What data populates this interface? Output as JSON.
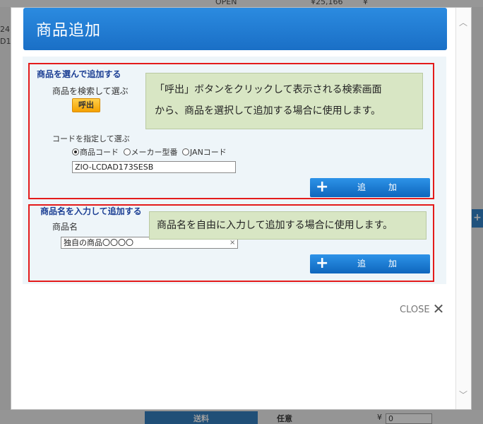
{
  "background": {
    "top_cells": [
      "OPEN",
      "¥25,166",
      "¥"
    ],
    "left_fragments": [
      "24",
      "D1"
    ],
    "right_tab": "+",
    "bottom_blue_label": "送料",
    "bottom_label": "任意",
    "bottom_yen": "¥",
    "bottom_input_value": "0"
  },
  "modal": {
    "title": "商品追加",
    "section_select": {
      "title": "商品を選んで追加する",
      "search_label": "商品を検索して選ぶ",
      "call_button": "呼出",
      "code_label": "コードを指定して選ぶ",
      "radio_options": [
        "商品コード",
        "メーカー型番",
        "JANコード"
      ],
      "selected_radio": "商品コード",
      "code_value": "ZIO-LCDAD173SESB",
      "add_button": "追　加"
    },
    "section_name": {
      "title": "商品名を入力して追加する",
      "name_label": "商品名",
      "name_value": "独自の商品〇〇〇〇",
      "clear_icon": "×",
      "add_button": "追　加"
    },
    "callout_select": "「呼出」ボタンをクリックして表示される検索画面から、商品を選択して追加する場合に使用します。",
    "callout_select_line1": "「呼出」ボタンをクリックして表示される検索画面",
    "callout_select_line2": "から、商品を選択して追加する場合に使用します。",
    "callout_name": "商品名を自由に入力して追加する場合に使用します。",
    "close_label": "CLOSE"
  }
}
